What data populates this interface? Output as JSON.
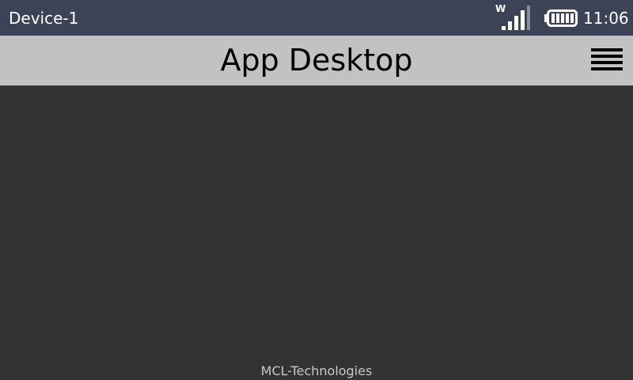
{
  "status_bar": {
    "device_name": "Device-1",
    "network_label": "W",
    "time": "11:06",
    "signal_icon": "signal-bars-icon",
    "battery_icon": "battery-icon"
  },
  "header": {
    "title": "App Desktop",
    "menu_icon": "hamburger-menu-icon"
  },
  "footer": {
    "text": "MCL-Technologies"
  },
  "colors": {
    "status_bar_bg": "#3c4356",
    "title_bar_bg": "#c2c2c2",
    "content_bg": "#333333",
    "footer_text": "#c8c8c8"
  }
}
